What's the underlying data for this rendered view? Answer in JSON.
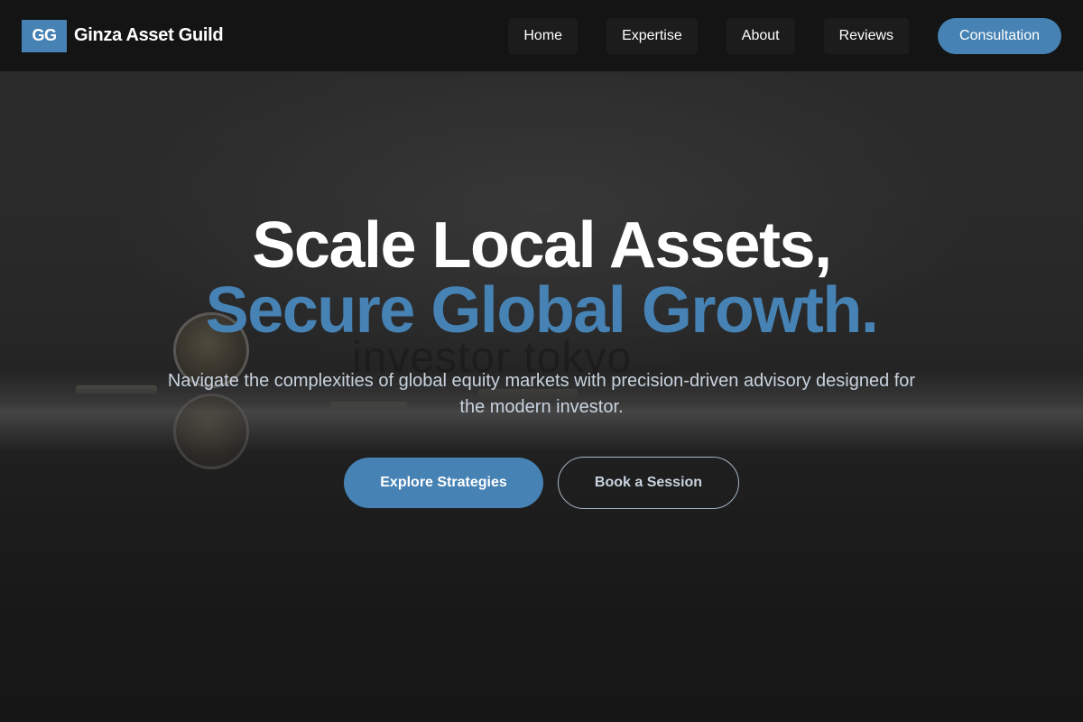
{
  "header": {
    "logo_text": "GG",
    "brand_name": "Ginza Asset Guild",
    "nav": [
      "Home",
      "Expertise",
      "About",
      "Reviews"
    ],
    "cta_label": "Consultation"
  },
  "hero": {
    "background_watermark": "investor tokyo",
    "headline_line1": "Scale Local Assets,",
    "headline_line2": "Secure Global Growth.",
    "subtitle": "Navigate the complexities of global equity markets with precision-driven advisory designed for the modern investor.",
    "primary_button": "Explore Strategies",
    "secondary_button": "Book a Session"
  },
  "colors": {
    "accent": "#4682b4",
    "header_bg": "#141414"
  }
}
